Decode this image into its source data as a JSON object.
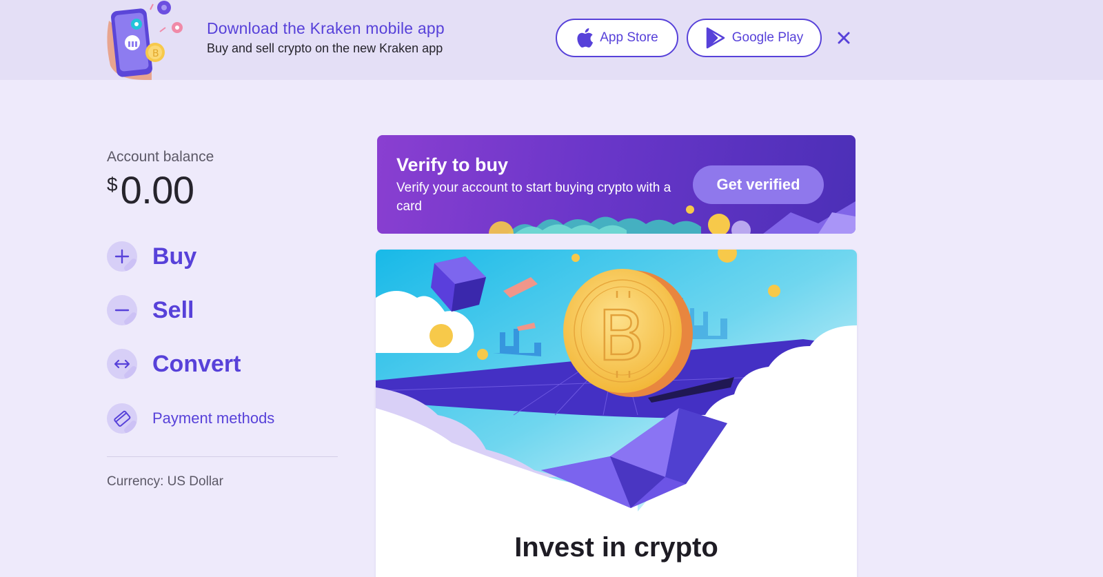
{
  "banner": {
    "title": "Download the Kraken mobile app",
    "subtitle": "Buy and sell crypto on the new Kraken app",
    "app_store_label": "App Store",
    "google_play_label": "Google Play",
    "close_icon": "close-icon"
  },
  "account": {
    "balance_label": "Account balance",
    "currency_symbol": "$",
    "balance_amount": "0.00"
  },
  "actions": [
    {
      "label": "Buy",
      "icon": "plus-icon"
    },
    {
      "label": "Sell",
      "icon": "minus-icon"
    },
    {
      "label": "Convert",
      "icon": "swap-arrows-icon"
    },
    {
      "label": "Payment methods",
      "icon": "card-icon"
    }
  ],
  "currency_text": "Currency: US Dollar",
  "verify": {
    "title": "Verify to buy",
    "description": "Verify your account to start buying crypto with a card",
    "button_label": "Get verified"
  },
  "invest": {
    "title": "Invest in crypto"
  },
  "colors": {
    "accent": "#5741d9",
    "background": "#eeeafb",
    "banner_bg": "#e4dff6",
    "verify_button": "#8f78ec"
  }
}
